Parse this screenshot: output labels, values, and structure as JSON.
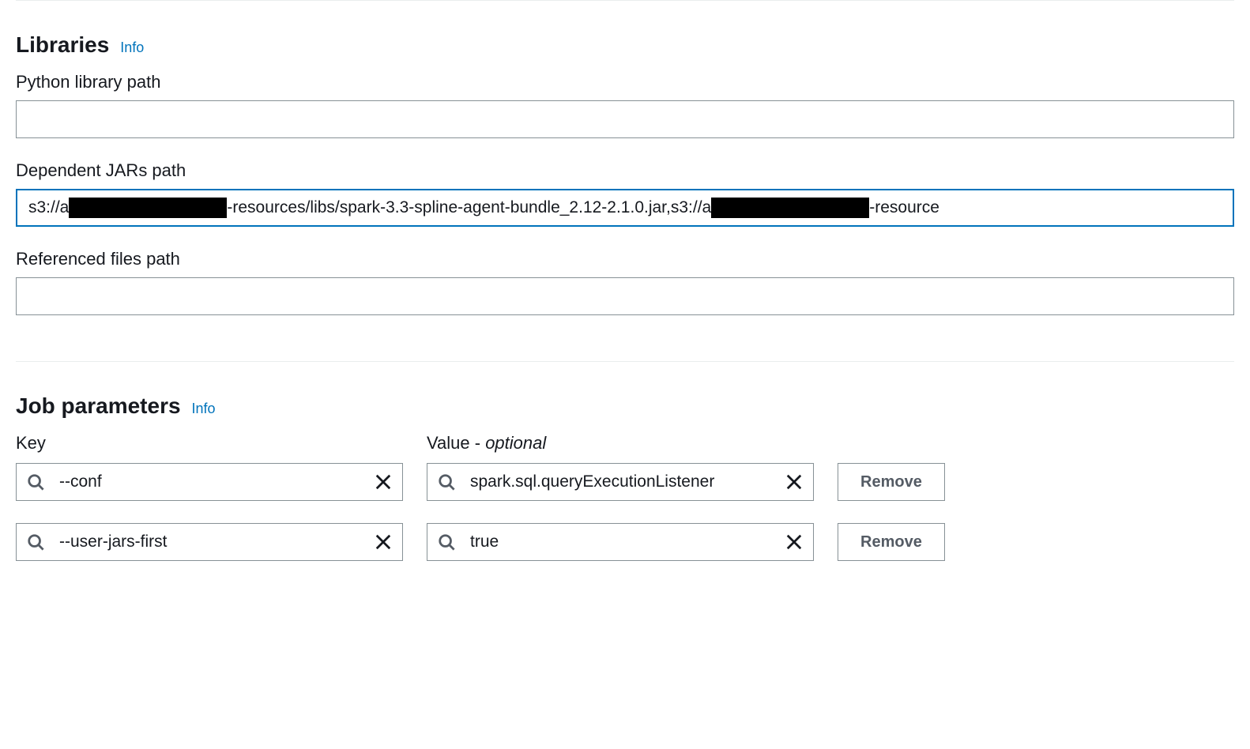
{
  "libraries": {
    "title": "Libraries",
    "info_label": "Info",
    "python_path": {
      "label": "Python library path",
      "value": ""
    },
    "jars_path": {
      "label": "Dependent JARs path",
      "prefix1": "s3://a",
      "middle": "-resources/libs/spark-3.3-spline-agent-bundle_2.12-2.1.0.jar,s3://a",
      "suffix": "-resource"
    },
    "referenced_path": {
      "label": "Referenced files path",
      "value": ""
    }
  },
  "job_parameters": {
    "title": "Job parameters",
    "info_label": "Info",
    "key_header": "Key",
    "value_header": "Value - ",
    "value_optional": "optional",
    "remove_label": "Remove",
    "rows": [
      {
        "key": "--conf",
        "value": "spark.sql.queryExecutionListener"
      },
      {
        "key": "--user-jars-first",
        "value": "true"
      }
    ]
  }
}
